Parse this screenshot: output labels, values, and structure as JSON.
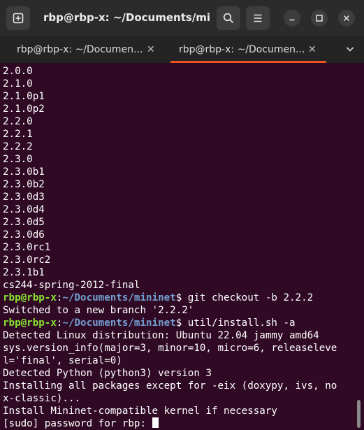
{
  "window": {
    "title": "rbp@rbp-x: ~/Documents/minin..."
  },
  "tabs": [
    {
      "label": "rbp@rbp-x: ~/Documen...",
      "close": "✕",
      "active": false
    },
    {
      "label": "rbp@rbp-x: ~/Documen...",
      "close": "✕",
      "active": true
    }
  ],
  "icons": {
    "new_tab": "new-tab-icon",
    "search": "search-icon",
    "menu": "hamburger-menu-icon",
    "minimize": "minimize-icon",
    "maximize": "maximize-icon",
    "close": "close-icon",
    "tab_list": "chevron-down-icon"
  },
  "colors": {
    "background": "#300a24",
    "prompt_user": "#8ae234",
    "prompt_path": "#729fcf",
    "active_tab": "#e95420"
  },
  "terminal": {
    "lines": [
      {
        "text": "2.0.0"
      },
      {
        "text": "2.1.0"
      },
      {
        "text": "2.1.0p1"
      },
      {
        "text": "2.1.0p2"
      },
      {
        "text": "2.2.0"
      },
      {
        "text": "2.2.1"
      },
      {
        "text": "2.2.2"
      },
      {
        "text": "2.3.0"
      },
      {
        "text": "2.3.0b1"
      },
      {
        "text": "2.3.0b2"
      },
      {
        "text": "2.3.0d3"
      },
      {
        "text": "2.3.0d4"
      },
      {
        "text": "2.3.0d5"
      },
      {
        "text": "2.3.0d6"
      },
      {
        "text": "2.3.0rc1"
      },
      {
        "text": "2.3.0rc2"
      },
      {
        "text": "2.3.1b1"
      },
      {
        "text": "cs244-spring-2012-final"
      },
      {
        "user": "rbp@rbp-x",
        "sep": ":",
        "path": "~/Documents/mininet",
        "command": "$ git checkout -b 2.2.2"
      },
      {
        "text": "Switched to a new branch '2.2.2'"
      },
      {
        "user": "rbp@rbp-x",
        "sep": ":",
        "path": "~/Documents/mininet",
        "command": "$ util/install.sh -a"
      },
      {
        "text": "Detected Linux distribution: Ubuntu 22.04 jammy amd64"
      },
      {
        "text": "sys.version_info(major=3, minor=10, micro=6, releaseleve"
      },
      {
        "text": "l='final', serial=0)"
      },
      {
        "text": "Detected Python (python3) version 3"
      },
      {
        "text": "Installing all packages except for -eix (doxypy, ivs, no"
      },
      {
        "text": "x-classic)..."
      },
      {
        "text": "Install Mininet-compatible kernel if necessary"
      },
      {
        "text": "[sudo] password for rbp: ",
        "cursor": true
      }
    ]
  }
}
